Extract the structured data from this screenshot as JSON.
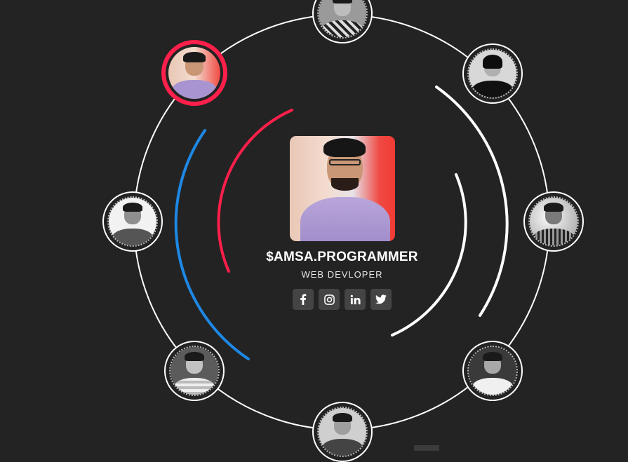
{
  "profile": {
    "name": "$AMSA.PROGRAMMER",
    "role": "WEB DEVLOPER"
  },
  "socials": [
    {
      "network": "facebook",
      "icon": "facebook-icon"
    },
    {
      "network": "instagram",
      "icon": "instagram-icon"
    },
    {
      "network": "linkedin",
      "icon": "linkedin-icon"
    },
    {
      "network": "twitter",
      "icon": "twitter-icon"
    }
  ],
  "avatars": [
    {
      "id": "top",
      "active": false
    },
    {
      "id": "top-left",
      "active": true
    },
    {
      "id": "top-right",
      "active": false
    },
    {
      "id": "left",
      "active": false
    },
    {
      "id": "right",
      "active": false
    },
    {
      "id": "bottom-left",
      "active": false
    },
    {
      "id": "bottom-right",
      "active": false
    },
    {
      "id": "bottom",
      "active": false
    }
  ],
  "colors": {
    "background": "#232323",
    "accent_red": "#ff1f4b",
    "accent_blue": "#1e88e5",
    "ring": "#ffffff",
    "button": "#444444"
  }
}
